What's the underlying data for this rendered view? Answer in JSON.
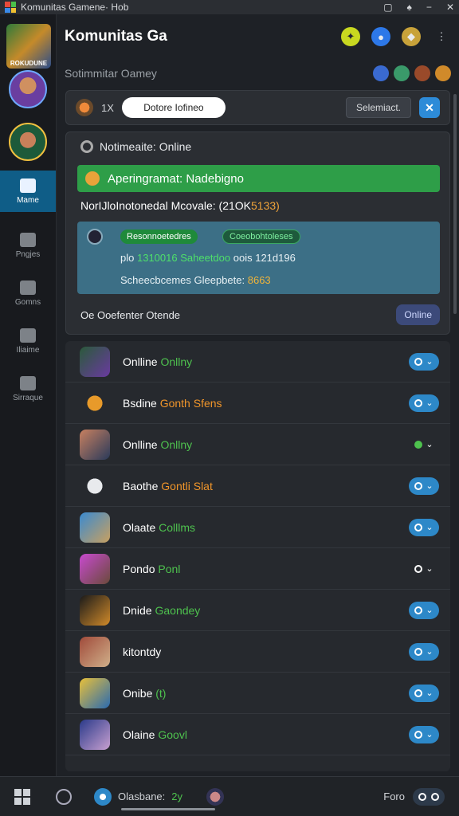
{
  "window": {
    "title": "Komunitas Gamene· Hob",
    "controls": [
      "▢",
      "♠",
      "−",
      "✕"
    ]
  },
  "header": {
    "app_title": "Komunitas Ga",
    "subtitle": "Sotimmitar Oamey"
  },
  "sidebar": {
    "logo_text": "ROKUDUNE",
    "items": [
      {
        "label": "Mame",
        "active": true
      },
      {
        "label": "Pngjes"
      },
      {
        "label": "Gomns"
      },
      {
        "label": "Iliaime"
      },
      {
        "label": "Sirraque"
      }
    ]
  },
  "search": {
    "count": "1X",
    "placeholder": "Dotore Iofineo",
    "select_label": "Selemiact.",
    "close_label": "✕"
  },
  "status": {
    "header": "Notimeaite: Online",
    "banner": "Aperingramat: Nadebigno",
    "notice_prefix": "NorIJloInotonedal Mcovale: (21OK",
    "notice_highlight": "5133)",
    "tags": [
      "Resonnoetedres",
      "Coeobohtoleses"
    ],
    "line1_prefix": "plo",
    "line1_green": "1310016",
    "line1_green2": "Saheetdoo",
    "line1_suffix": "oois 121d196",
    "line2_prefix": "Scheecbcemes Gleepbete:",
    "line2_highlight": "8663",
    "footer": "Oe Ooefenter Otende",
    "online_button": "Online"
  },
  "games": [
    {
      "name": "Onlline",
      "status": "Onllny",
      "status_color": "green",
      "toggle": "on"
    },
    {
      "name": "Bsdine",
      "status": "Gonth Sfens",
      "status_color": "orange",
      "toggle": "on"
    },
    {
      "name": "Onlline",
      "status": "Onllny",
      "status_color": "green",
      "toggle": "dot"
    },
    {
      "name": "Baothe",
      "status": "Gontli Slat",
      "status_color": "orange",
      "toggle": "on"
    },
    {
      "name": "Olaate",
      "status": "Colllms",
      "status_color": "green",
      "toggle": "on"
    },
    {
      "name": "Pondo",
      "status": "Ponl",
      "status_color": "green",
      "toggle": "off"
    },
    {
      "name": "Dnide",
      "status": "Gaondey",
      "status_color": "green",
      "toggle": "on"
    },
    {
      "name": "kitontdy",
      "status": "",
      "status_color": "green",
      "toggle": "on"
    },
    {
      "name": "Onibe",
      "status": "(t)",
      "status_color": "green",
      "toggle": "on"
    },
    {
      "name": "Olaine",
      "status": "Goovl",
      "status_color": "green",
      "toggle": "on"
    }
  ],
  "taskbar": {
    "app_label": "Olasbane:",
    "app_label_green": "2y",
    "right_label": "Foro"
  },
  "colors": {
    "accent_blue": "#2d88c8",
    "online_green": "#4ec24e",
    "warn_orange": "#f0952a",
    "banner_green": "#2e9e48"
  }
}
